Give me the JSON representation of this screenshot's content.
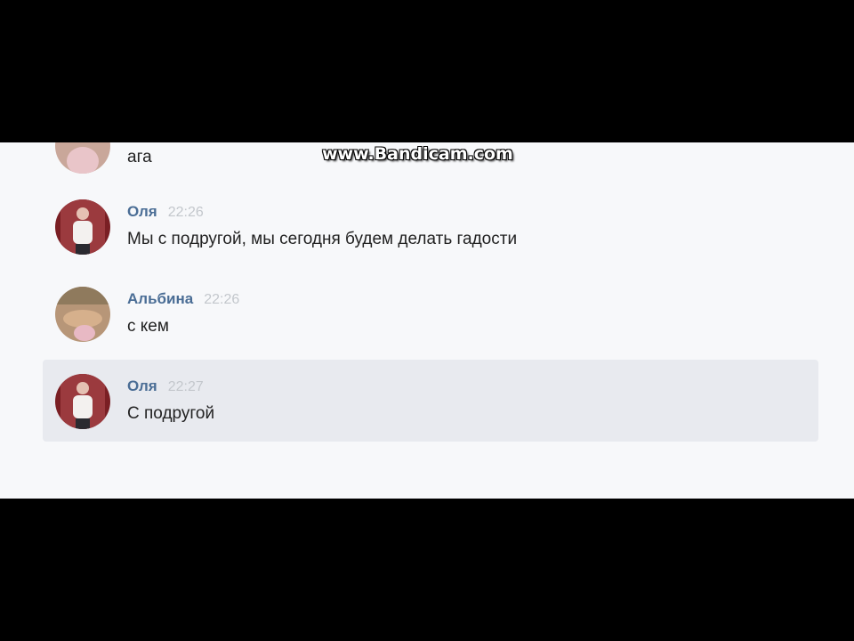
{
  "watermark": "www.Bandicam.com",
  "messages": [
    {
      "author": "",
      "time": "",
      "text": "ага",
      "avatar": "avatar-pink-icon"
    },
    {
      "author": "Оля",
      "time": "22:26",
      "text": "Мы с подругой, мы сегодня будем делать гадости",
      "avatar": "avatar-red-icon"
    },
    {
      "author": "Альбина",
      "time": "22:26",
      "text": "с кем",
      "avatar": "avatar-tan-icon"
    },
    {
      "author": "Оля",
      "time": "22:27",
      "text": "С подругой",
      "avatar": "avatar-red-icon"
    }
  ],
  "colors": {
    "author": "#4a6d95",
    "time": "#c3c7cc",
    "highlight": "#e8eaef",
    "background": "#f7f8fa"
  }
}
